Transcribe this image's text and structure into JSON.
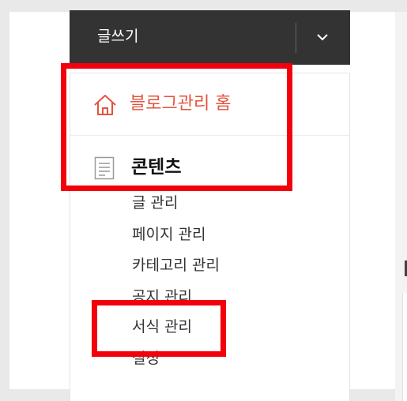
{
  "write_button": {
    "label": "글쓰기",
    "dropdown_icon": "chevron-down-icon"
  },
  "menu": {
    "home": {
      "label": "블로그관리 홈",
      "icon": "home-icon",
      "color": "#e4533d"
    },
    "contents": {
      "label": "콘텐츠",
      "icon": "document-icon"
    },
    "items": [
      {
        "label": "글 관리"
      },
      {
        "label": "페이지 관리"
      },
      {
        "label": "카테고리 관리"
      },
      {
        "label": "공지 관리"
      },
      {
        "label": "서식 관리"
      },
      {
        "label": "설정"
      }
    ]
  },
  "highlight_color": "#f2000b"
}
